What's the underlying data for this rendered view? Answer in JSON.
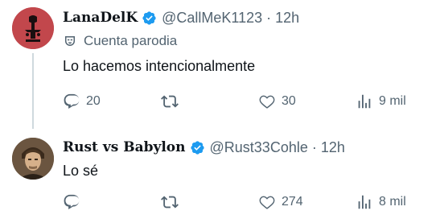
{
  "tweets": [
    {
      "display_name": "LanaDelK",
      "handle": "@CallMeK1123",
      "dot": "·",
      "time": "12h",
      "label": "Cuenta parodia",
      "text": "Lo hacemos intencionalmente",
      "replies": "20",
      "retweets": "",
      "likes": "30",
      "views": "9 mil"
    },
    {
      "display_name": "Rust vs Babylon",
      "handle": "@Rust33Cohle",
      "dot": "·",
      "time": "12h",
      "text": "Lo sé",
      "replies": "",
      "retweets": "",
      "likes": "274",
      "views": "8 mil"
    }
  ],
  "colors": {
    "verified": "#1d9bf0",
    "muted": "#536471",
    "thread_line": "#cfd9de"
  },
  "icons": [
    "reply-icon",
    "retweet-icon",
    "like-icon",
    "views-icon",
    "verified-badge-icon",
    "parody-mask-icon"
  ]
}
